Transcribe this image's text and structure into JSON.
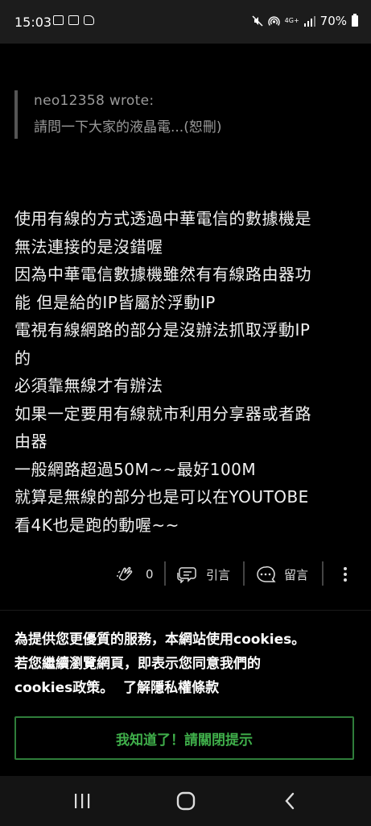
{
  "status_bar": {
    "time": "15:03",
    "network": "4G+",
    "battery": "70%",
    "icons": [
      "notification-icon",
      "image-icon",
      "app-icon",
      "mute-icon",
      "hotspot-icon",
      "signal-icon",
      "battery-icon"
    ]
  },
  "quote": {
    "author": "neo12358 wrote:",
    "text": "請問一下大家的液晶電...(恕刪)"
  },
  "post": {
    "lines": [
      "使用有線的方式透過中華電信的數據機是",
      "無法連接的是沒錯喔",
      "因為中華電信數據機雖然有有線路由器功",
      "能 但是給的IP皆屬於浮動IP",
      "電視有線網路的部分是沒辦法抓取浮動IP",
      "的",
      "必須靠無線才有辦法",
      "如果一定要用有線就市利用分享器或者路",
      "由器",
      "一般網路超過50M~~最好100M",
      "就算是無線的部分也是可以在YOUTOBE",
      "看4K也是跑的動喔~~"
    ]
  },
  "actions": {
    "like_count": "0",
    "quote_label": "引言",
    "comment_label": "留言"
  },
  "cookie_notice": {
    "line1": "為提供您更優質的服務，本網站使用cookies。",
    "line2": "若您繼續瀏覽網頁，即表示您同意我們的",
    "line3_prefix": "cookies政策。",
    "privacy_link": "了解隱私權條款",
    "dismiss_button": "我知道了！請關閉提示"
  },
  "colors": {
    "accent_green": "#3fae4a",
    "button_border": "#2f7d3a"
  }
}
